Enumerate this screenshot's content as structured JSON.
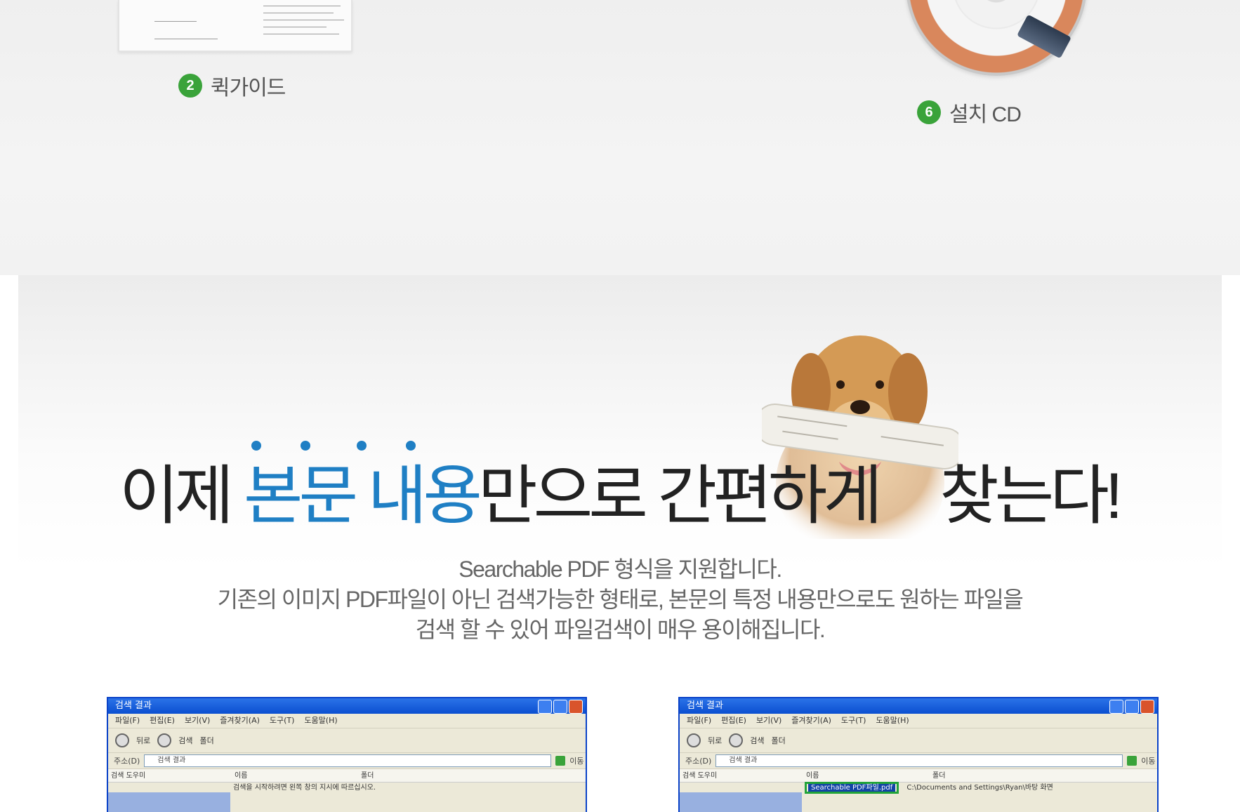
{
  "top": {
    "items": [
      {
        "number": "2",
        "label": "퀵가이드"
      },
      {
        "number": "6",
        "label": "설치 CD"
      }
    ],
    "badge_color": "#3aa33a"
  },
  "promo": {
    "headline": {
      "pre": "이제 ",
      "highlight": "본문 내용",
      "post": "만으로 간편하게",
      "end": "찾는다!"
    },
    "highlight_color": "#1f7fc4",
    "description": [
      "Searchable PDF 형식을 지원합니다.",
      "기존의 이미지 PDF파일이 아닌 검색가능한 형태로, 본문의 특정 내용만으로도 원하는 파일을",
      "검색 할 수 있어 파일검색이 매우 용이해집니다."
    ]
  },
  "windows": [
    {
      "title": "검색 결과",
      "menu": [
        "파일(F)",
        "편집(E)",
        "보기(V)",
        "즐겨찾기(A)",
        "도구(T)",
        "도움말(H)"
      ],
      "toolbar": [
        "뒤로",
        "검색",
        "폴더"
      ],
      "address_label": "주소(D)",
      "address": "검색 결과",
      "go": "이동",
      "columns": [
        "검색 도우미",
        "이름",
        "폴더"
      ],
      "result": "검색을 시작하려면 왼쪽 창의 지시에 따르십시오.",
      "highlight": ""
    },
    {
      "title": "검색 결과",
      "menu": [
        "파일(F)",
        "편집(E)",
        "보기(V)",
        "즐겨찾기(A)",
        "도구(T)",
        "도움말(H)"
      ],
      "toolbar": [
        "뒤로",
        "검색",
        "폴더"
      ],
      "address_label": "주소(D)",
      "address": "검색 결과",
      "go": "이동",
      "columns": [
        "검색 도우미",
        "이름",
        "폴더"
      ],
      "result": "C:\\Documents and Settings\\Ryan\\바탕 화면",
      "highlight": "Searchable PDF파일.pdf"
    }
  ]
}
